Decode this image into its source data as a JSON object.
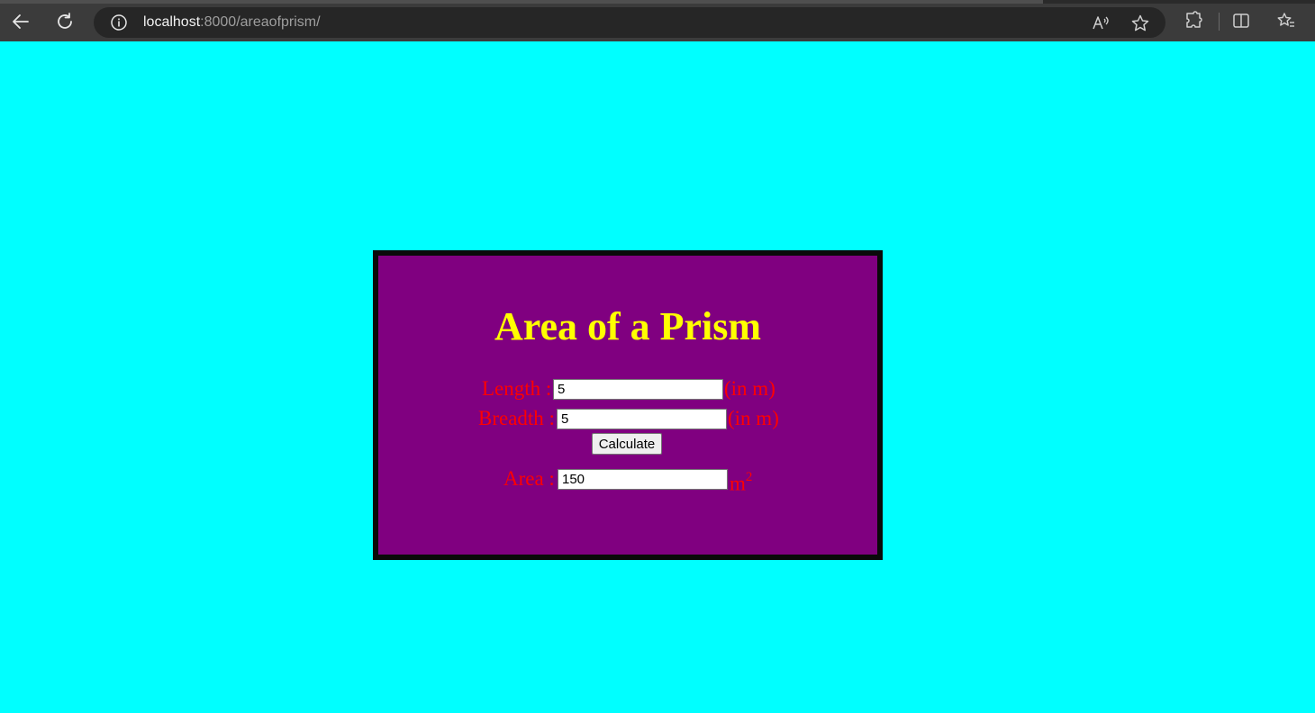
{
  "browser": {
    "url_host": "localhost",
    "url_path": ":8000/areaofprism/",
    "icons": [
      "back-arrow-icon",
      "refresh-icon",
      "info-icon",
      "read-aloud-icon",
      "favorite-star-icon",
      "extensions-icon",
      "split-screen-icon",
      "favorites-list-icon"
    ]
  },
  "page": {
    "title": "Area of a Prism",
    "length_label": "Length :",
    "length_value": "5",
    "length_unit": "(in m)",
    "breadth_label": "Breadth :",
    "breadth_value": "5",
    "breadth_unit": "(in m)",
    "calculate_label": "Calculate",
    "area_label": "Area :",
    "area_value": "150",
    "area_unit": "m",
    "area_unit_exp": "2"
  },
  "colors": {
    "background": "#00ffff",
    "card": "#800080",
    "border": "#00ff00",
    "title": "#ffff00",
    "labels": "#ff0000"
  }
}
